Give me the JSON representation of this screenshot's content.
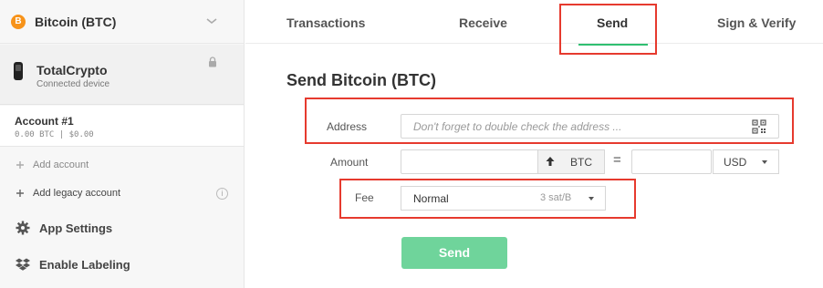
{
  "sidebar": {
    "coin": {
      "logo": "B",
      "name": "Bitcoin (BTC)",
      "icons": [
        "bitcoin-logo-icon",
        "chevron-down-icon"
      ]
    },
    "device": {
      "name": "TotalCrypto",
      "status": "Connected device",
      "icons": [
        "hardware-wallet-icon",
        "lock-icon"
      ]
    },
    "account": {
      "name": "Account #1",
      "balance": "0.00 BTC  |  $0.00"
    },
    "add_account": "Add account",
    "add_legacy_account": "Add legacy account",
    "info_glyph": "i",
    "app_settings": "App Settings",
    "enable_labeling": "Enable Labeling"
  },
  "tabs": [
    {
      "label": "Transactions"
    },
    {
      "label": "Receive"
    },
    {
      "label": "Send",
      "active": true
    },
    {
      "label": "Sign & Verify"
    }
  ],
  "form": {
    "title": "Send Bitcoin (BTC)",
    "address": {
      "label": "Address",
      "placeholder": "Don't forget to double check the address ...",
      "value": ""
    },
    "amount": {
      "label": "Amount",
      "value": "",
      "unit": "BTC",
      "equals": "=",
      "fiat_value": "",
      "fiat_currency": "USD"
    },
    "fee": {
      "label": "Fee",
      "level": "Normal",
      "rate": "3 sat/B"
    },
    "send_label": "Send"
  },
  "colors": {
    "accent": "#2fbf71",
    "send_button": "#6fd49b",
    "highlight": "#e63a2e",
    "btc": "#f7931a"
  }
}
